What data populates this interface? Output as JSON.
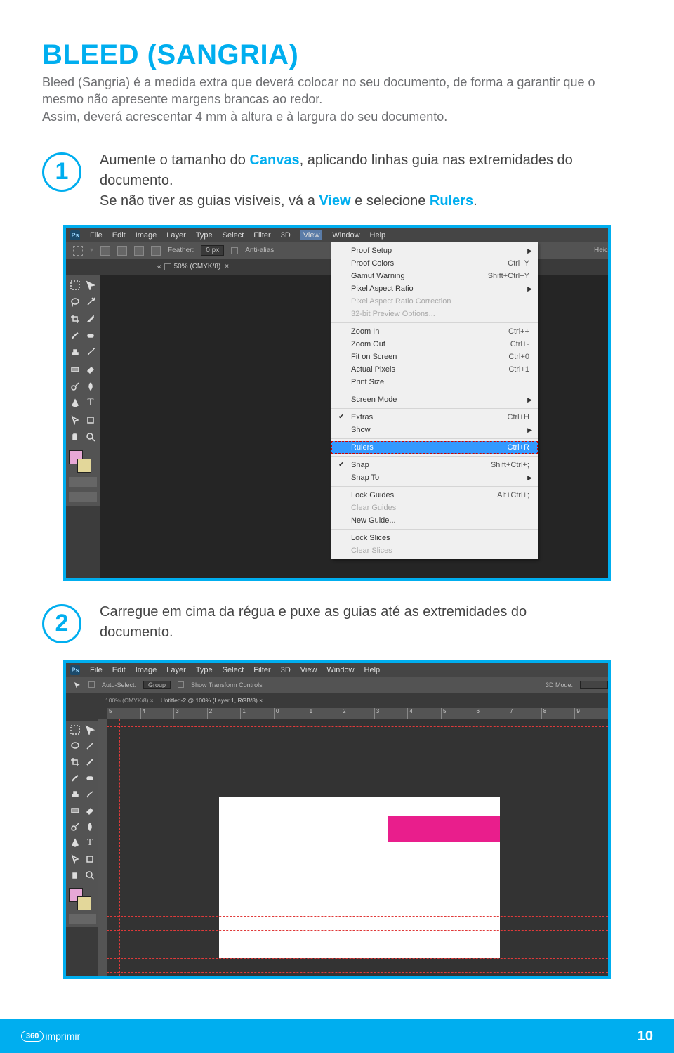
{
  "page": {
    "title": "BLEED (SANGRIA)",
    "intro_l1": "Bleed (Sangria) é a medida extra que deverá colocar no seu documento, de forma a garantir que o mesmo não apresente margens brancas ao redor.",
    "intro_l2": "Assim, deverá acrescentar 4 mm à altura e à largura do seu documento."
  },
  "steps": {
    "s1": {
      "num": "1",
      "t1": "Aumente o tamanho do ",
      "kw1": "Canvas",
      "t2": ", aplicando linhas guia nas extremidades do documento.",
      "t3": "Se não tiver as guias visíveis, vá a ",
      "kw2": "View",
      "t4": " e selecione ",
      "kw3": "Rulers",
      "t5": "."
    },
    "s2": {
      "num": "2",
      "t1": "Carregue em cima da régua e puxe as guias até as extremidades do documento."
    }
  },
  "ps1": {
    "menubar": [
      "File",
      "Edit",
      "Image",
      "Layer",
      "Type",
      "Select",
      "Filter",
      "3D",
      "View",
      "Window",
      "Help"
    ],
    "optbar": {
      "feather_label": "Feather:",
      "feather_value": "0 px",
      "anti": "Anti-alias",
      "heic": "Heic"
    },
    "tab": {
      "close": "«",
      "name": "50% (CMYK/8)",
      "x": "×"
    },
    "view_menu": {
      "g1": [
        {
          "label": "Proof Setup",
          "sc": "",
          "arrow": true
        },
        {
          "label": "Proof Colors",
          "sc": "Ctrl+Y"
        },
        {
          "label": "Gamut Warning",
          "sc": "Shift+Ctrl+Y"
        },
        {
          "label": "Pixel Aspect Ratio",
          "sc": "",
          "arrow": true
        },
        {
          "label": "Pixel Aspect Ratio Correction",
          "sc": "",
          "disabled": true
        },
        {
          "label": "32-bit Preview Options...",
          "sc": "",
          "disabled": true
        }
      ],
      "g2": [
        {
          "label": "Zoom In",
          "sc": "Ctrl++"
        },
        {
          "label": "Zoom Out",
          "sc": "Ctrl+-"
        },
        {
          "label": "Fit on Screen",
          "sc": "Ctrl+0"
        },
        {
          "label": "Actual Pixels",
          "sc": "Ctrl+1"
        },
        {
          "label": "Print Size",
          "sc": ""
        }
      ],
      "g3": [
        {
          "label": "Screen Mode",
          "sc": "",
          "arrow": true
        }
      ],
      "g4": [
        {
          "label": "Extras",
          "sc": "Ctrl+H",
          "checked": true
        },
        {
          "label": "Show",
          "sc": "",
          "arrow": true
        }
      ],
      "g5": [
        {
          "label": "Rulers",
          "sc": "Ctrl+R",
          "rulers": true
        }
      ],
      "g6": [
        {
          "label": "Snap",
          "sc": "Shift+Ctrl+;",
          "checked": true
        },
        {
          "label": "Snap To",
          "sc": "",
          "arrow": true
        }
      ],
      "g7": [
        {
          "label": "Lock Guides",
          "sc": "Alt+Ctrl+;"
        },
        {
          "label": "Clear Guides",
          "sc": "",
          "disabled": true
        },
        {
          "label": "New Guide...",
          "sc": ""
        }
      ],
      "g8": [
        {
          "label": "Lock Slices",
          "sc": ""
        },
        {
          "label": "Clear Slices",
          "sc": "",
          "disabled": true
        }
      ]
    }
  },
  "ps2": {
    "menubar": [
      "File",
      "Edit",
      "Image",
      "Layer",
      "Type",
      "Select",
      "Filter",
      "3D",
      "View",
      "Window",
      "Help"
    ],
    "optbar": {
      "auto": "Auto-Select:",
      "group": "Group",
      "stc": "Show Transform Controls",
      "mode": "3D Mode:"
    },
    "tabs": {
      "t1": "100% (CMYK/8) ×",
      "t2": "Untitled-2 @ 100% (Layer 1, RGB/8) ×"
    },
    "ruler": [
      "5",
      "4",
      "3",
      "2",
      "1",
      "0",
      "1",
      "2",
      "3",
      "4",
      "5",
      "6",
      "7",
      "8",
      "9"
    ]
  },
  "footer": {
    "brand_num": "360",
    "brand_txt": "imprimir",
    "page": "10"
  }
}
